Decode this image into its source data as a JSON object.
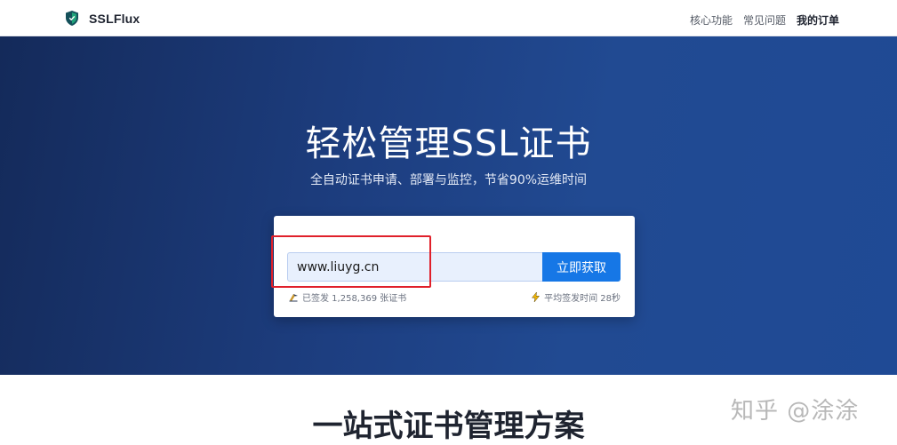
{
  "brand": {
    "name": "SSLFlux",
    "logo_icon": "shield-icon"
  },
  "nav": {
    "items": [
      {
        "label": "核心功能",
        "active": false
      },
      {
        "label": "常见问题",
        "active": false
      },
      {
        "label": "我的订单",
        "active": true
      }
    ]
  },
  "hero": {
    "title": "轻松管理SSL证书",
    "subtitle": "全自动证书申请、部署与监控，节省90%运维时间"
  },
  "form": {
    "domain_value": "www.liuyg.cn",
    "submit_label": "立即获取",
    "issued_text": "已签发 1,258,369 张证书",
    "issued_icon": "certificate-icon",
    "avg_time_text": "平均签发时间 28秒",
    "avg_time_icon": "lightning-icon"
  },
  "section": {
    "title": "一站式证书管理方案"
  },
  "watermark": {
    "text": "知乎 @涂涂"
  },
  "colors": {
    "accent": "#1677e6",
    "hero_bg": "#1d3e80",
    "highlight": "#e0202a"
  }
}
